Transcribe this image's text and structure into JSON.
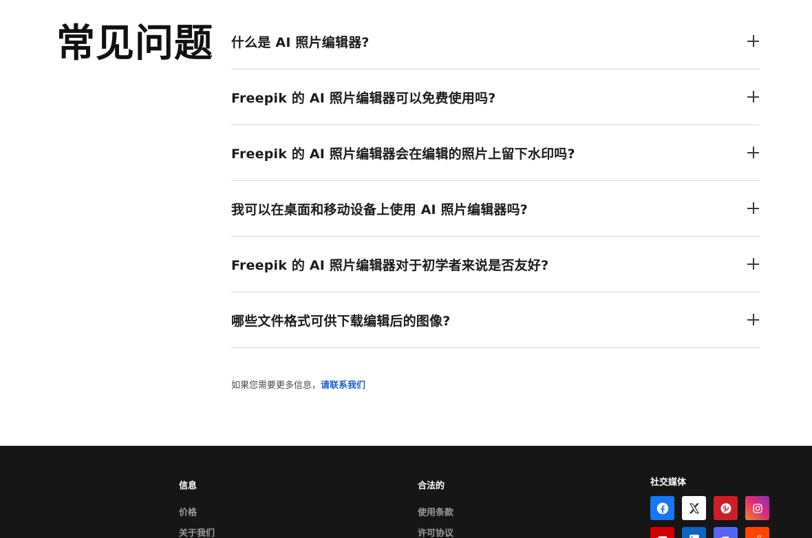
{
  "faq": {
    "title": "常见问题",
    "items": [
      {
        "question": "什么是 AI 照片编辑器?"
      },
      {
        "question": "Freepik 的 AI 照片编辑器可以免费使用吗?"
      },
      {
        "question": "Freepik 的 AI 照片编辑器会在编辑的照片上留下水印吗?"
      },
      {
        "question": "我可以在桌面和移动设备上使用 AI 照片编辑器吗?"
      },
      {
        "question": "Freepik 的 AI 照片编辑器对于初学者来说是否友好?"
      },
      {
        "question": "哪些文件格式可供下载编辑后的图像?"
      }
    ],
    "contact_prefix": "如果您需要更多信息，",
    "contact_link": "请联系我们"
  },
  "footer": {
    "info": {
      "heading": "信息",
      "links": [
        "价格",
        "关于我们"
      ]
    },
    "legal": {
      "heading": "合法的",
      "links": [
        "使用条款",
        "许可协议"
      ]
    },
    "social": {
      "heading": "社交媒体",
      "networks": [
        {
          "icon": "facebook-icon",
          "color": "#1877f2"
        },
        {
          "icon": "x-icon",
          "color": "#ffffff"
        },
        {
          "icon": "pinterest-icon",
          "color": "#cb1f27"
        },
        {
          "icon": "instagram-icon",
          "color": "#d6249f"
        },
        {
          "icon": "youtube-icon",
          "color": "#d40000"
        },
        {
          "icon": "linkedin-icon",
          "color": "#0a66c2"
        },
        {
          "icon": "discord-icon",
          "color": "#5865f2"
        },
        {
          "icon": "reddit-icon",
          "color": "#ff4500"
        }
      ]
    }
  }
}
